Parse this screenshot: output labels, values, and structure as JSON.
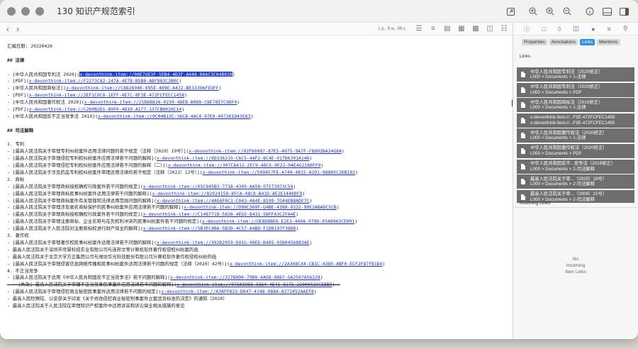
{
  "window": {
    "title": "130 知识产规范索引"
  },
  "titlebar_icons": [
    "open-external-icon",
    "zoom-in-icon",
    "zoom-in-icon",
    "zoom-out-icon",
    "info-icon",
    "sidebar-bottom-icon",
    "sidebar-right-icon"
  ],
  "toolbar": {
    "page_info": "1 p., 8 w., 56 c"
  },
  "document": {
    "date_line": "汇编日期: 20220426",
    "section1_heading": "## 法律",
    "section2_heading": "## 司法解释",
    "law_items": [
      {
        "prefix": "- [中华人民共和国专利法 2020](",
        "link": "x-devonthink-item://00E7GE3F-5EB4-4D2F-A448-80AC3C04B928",
        "suffix": ")",
        "highlight": true
      },
      {
        "prefix": "  - [PDF](",
        "link": "x-devonthink-item://F2273C82-247A-4E7B-B5B8-ABF883C3B0C",
        "suffix": ")"
      },
      {
        "prefix": "- [中华人民共和国商标法](",
        "link": "x-devonthink-item://C8826946-695E-409E-A432-BE33396FEOFF",
        "suffix": ")"
      },
      {
        "prefix": "  - [PDF](",
        "link": "x-devonthink-item://2EF1C0C0-1EFF-4E7C-8F3E-472FCFECC1458",
        "suffix": ")"
      },
      {
        "prefix": "- [中华人民共和国著作权法 2020](",
        "link": "x-devonthink-item://21B6B826-0239-4DEB-B0DD-C8E7857C9DF4",
        "suffix": ")"
      },
      {
        "prefix": "  - [PDF](",
        "link": "x-devonthink-item://C260B2D1-80F0-4819-A177-137CB8020C14",
        "suffix": ")"
      },
      {
        "prefix": "- [中华人民共和国反不正当竞争法 2019](",
        "link": "x-devonthink-item://9C04B13C-36C8-4AC4-97E0-497261D43E63",
        "suffix": ")"
      }
    ],
    "judicial_groups": [
      {
        "heading": "1. 专利",
        "items": [
          {
            "prefix": "  - [最高人民法院关于审理专利纠纷案件适用法律问题的若干规定（法释〔2020〕19号）](",
            "link": "x-devonthink-item://02F60087-87E5-4075-9A7F-F8802BA24G8A",
            "suffix": ")"
          },
          {
            "prefix": "  - [最高人民法院关于审理侵犯专利权纠纷案件应用法律若干问题的解释](",
            "link": "x-devonthink-item://9D33621G-C6C5-44F2-8C4E-017D6391A146",
            "suffix": ")"
          },
          {
            "prefix": "  - [最高人民法院关于审理侵犯专利权纠纷案件应用法律若干问题的解释（二）](",
            "link": "x-devonthink-item://307C8412-2FC9-48C5-9E22-04E4G2180FF9",
            "suffix": ")"
          },
          {
            "prefix": "  - [最高人民法院关于涉及药品专利权纠纷案件审理适用法律的若干规定（法释〔2022〕12号）](",
            "link": "x-devonthink-item://509857FE-A749-4B15-82D1-98885C26B192",
            "suffix": ")"
          }
        ]
      },
      {
        "heading": "2. 商标",
        "items": [
          {
            "prefix": "  - [最高人民法院关于审理商标授权确权行政案件若干问题的规定](",
            "link": "x-devonthink-item://65C845B3-7718-4349-AA58-07573973C54",
            "suffix": ")"
          },
          {
            "prefix": "  - [最高人民法院关于审理商标民事纠纷案件适用法律若干问题的解释](",
            "link": "x-devonthink-item://82924150-8FCA-48C8-B41D-AE2E1440DF9",
            "suffix": ")"
          },
          {
            "prefix": "  - [最高人民法院关于审理商标案件有关管辖和法律适用范围问题的解释](",
            "link": "x-devonthink-item://4AGAF0C3-C043-4A4E-8599-7G44EB8ADE7C",
            "suffix": ")"
          },
          {
            "prefix": "  - [最高人民法院关于审理涉及驰名商标保护的民事纠纷案件应用法律若干问题的解释](",
            "link": "x-devonthink-item://D98C360F-G4BE-4389-9332-90E2ABADC5CB",
            "suffix": ")"
          },
          {
            "prefix": "  - [最高人民法院关于审理商标授权确权行政案件若干问题的规定](",
            "link": "x-devonthink-item://C1487718-5838-4EG5-8431-58FFA3C2FA4E",
            "suffix": ")"
          },
          {
            "prefix": "  - [最高人民法院关于审理注册商标、企业名称与在先权利冲突的民事纠纷案件若干问题的规定](",
            "link": "x-devonthink-item://GE8D8BE8-E2E3-440A-979D-93489A3CE091",
            "suffix": ")"
          },
          {
            "prefix": "  - [最高人民法院关于人民法院对注册商标权进行财产保全的解释](",
            "link": "x-devonthink-item://5B3FC4BA-5B3D-4C57-A4BD-F1DB197F38DB",
            "suffix": ")"
          }
        ]
      },
      {
        "heading": "3. 著作权",
        "items": [
          {
            "prefix": "  - [最高人民法院关于审理著作权民事纠纷案件适用法律若干问题的解释](",
            "link": "x-devonthink-item://392D2959-D91G-49ED-B485-03B0456883AE",
            "suffix": ")"
          },
          {
            "prefix": "  - 最高人民法院关于深圳市帝慧科技实业有限公司与连邦文等计算机软件著作权侵权纠纷案的函",
            "link": "",
            "suffix": ""
          },
          {
            "prefix": "  - 最高人民法院关于北京大学方正集团公司与潍坊华光科技股份有限公司计算机软件著作权侵权纠纷的函",
            "link": "",
            "suffix": ""
          },
          {
            "prefix": "  - [最高人民法院关于审理侵害信息网络传播权民事纠纷案件适用法律若干问题的规定（法释〔2020〕42号）](",
            "link": "x-devonthink-item://2A348C44-CB1C-4389-ABF0-ECF2F87FB1D4",
            "suffix": ")"
          }
        ]
      },
      {
        "heading": "4. 不正当竞争",
        "items": [
          {
            "prefix": "  - [最高人民法院关于适用《中华人民共和国反不正当竞争法》若干问题的解释](",
            "link": "x-devonthink-item://327D0D0-79D8-4AG8-8887-GA2507A56228",
            "suffix": ")"
          },
          {
            "prefix": "  - ~~[失效] 最高人民法院关于审理不正当竞争民事案件应用法律若干问题的解释](",
            "link": "x-devonthink-item://07G03988-A364-4E41-8175-22000A2AC88B9",
            "suffix": ")~~",
            "strike": true
          },
          {
            "prefix": "  - [最高人民法院关于审理侵犯商业秘密民事案件适用法律若干问题的规定](",
            "link": "x-devonthink-item://A38FF823-D047-4148-988A-8372452AAEF8",
            "suffix": ")"
          },
          {
            "prefix": "  - 最高人民检察院、公安部关于印发《关于修改侵犯商业秘密刑事案件立案追诉标准的决定》的通知（2020）",
            "link": "",
            "suffix": ""
          },
          {
            "prefix": "  - 最高人民法院关于人民法院在审理知识产权案件中适用诉前和诉讼保全相关措施的意见",
            "link": "",
            "suffix": ""
          }
        ]
      }
    ]
  },
  "inspector": {
    "tabs": [
      {
        "label": "Properties",
        "active": false
      },
      {
        "label": "Annotations",
        "active": false
      },
      {
        "label": "Links",
        "active": true
      },
      {
        "label": "Mentions",
        "active": false
      }
    ],
    "links_title": "Links",
    "links": [
      {
        "title": "中华人民共和国专利法（2020修正）",
        "path": "L000 > Documents > 1-法律"
      },
      {
        "title": "中华人民共和国专利法（2020修正）",
        "path": "L000 > Documents > PDF"
      },
      {
        "title": "中华人民共和国商标法（2019修正）",
        "path": "L000 > Documents > 1-法律"
      },
      {
        "title": "x-devonthink-item://...F3E-472FCFEC1450",
        "path": "x-devonthink-item://...F3E-472FCFEC1450"
      },
      {
        "title": "中华人民共和国著作权法（2020修正）",
        "path": "L000 > Documents > 1-法律"
      },
      {
        "title": "中华人民共和国著作权法（2020修正）",
        "path": "L000 > Documents > PDF"
      },
      {
        "title": "中华人民共和国反不...竞争法（2019修正）",
        "path": "L000 > Documents > 2-司法解释"
      },
      {
        "title": "最高人民法院关于审...（2020）19号）",
        "path": "L000 > Documents > 2-司法解释"
      },
      {
        "title": "最高人民法院关于审...（2009）21号）",
        "path": "L000 > Documents > 2-司法解释"
      }
    ],
    "incoming_title": "Incoming Links",
    "no_incoming": [
      "No",
      "Incoming",
      "Item Links"
    ]
  },
  "colors": {
    "link": "#1d2fc0",
    "highlight": "#1d3ad0",
    "tab_active": "#2f8fe0",
    "link_item_bg": "#6e6e6e"
  }
}
